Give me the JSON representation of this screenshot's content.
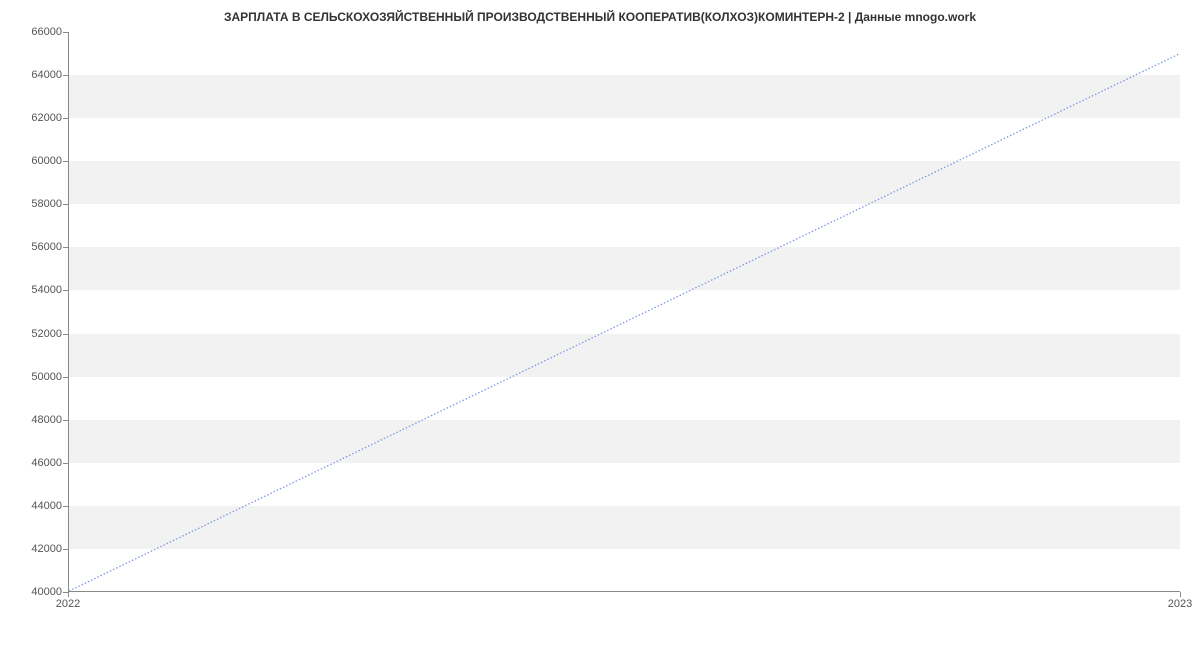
{
  "chart_data": {
    "type": "line",
    "title": "ЗАРПЛАТА В СЕЛЬСКОХОЗЯЙСТВЕННЫЙ ПРОИЗВОДСТВЕННЫЙ КООПЕРАТИВ(КОЛХОЗ)КОМИНТЕРН-2 | Данные mnogo.work",
    "x": [
      2022,
      2023
    ],
    "values": [
      40000,
      65000
    ],
    "xlabel": "",
    "ylabel": "",
    "xlim": [
      2022,
      2023
    ],
    "ylim": [
      40000,
      66000
    ],
    "y_ticks": [
      40000,
      42000,
      44000,
      46000,
      48000,
      50000,
      52000,
      54000,
      56000,
      58000,
      60000,
      62000,
      64000,
      66000
    ],
    "x_ticks": [
      2022,
      2023
    ],
    "line_color": "#7a9ae0",
    "band_color": "#f2f2f2"
  }
}
